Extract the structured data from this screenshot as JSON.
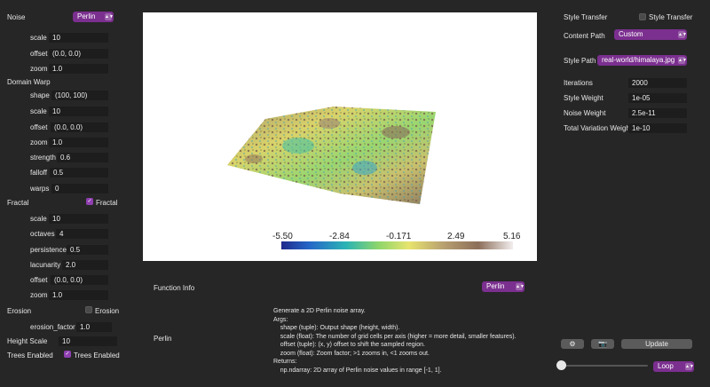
{
  "left": {
    "noise_label": "Noise",
    "noise_select": "Perlin",
    "noise_params": [
      {
        "label": "scale",
        "value": "10"
      },
      {
        "label": "offset",
        "value": "(0.0, 0.0)"
      },
      {
        "label": "zoom",
        "value": "1.0"
      }
    ],
    "domain_warp_label": "Domain Warp",
    "domain_warp_params": [
      {
        "label": "shape",
        "value": "(100, 100)"
      },
      {
        "label": "scale",
        "value": "10"
      },
      {
        "label": "offset",
        "value": "(0.0, 0.0)"
      },
      {
        "label": "zoom",
        "value": "1.0"
      },
      {
        "label": "strength",
        "value": "0.6"
      },
      {
        "label": "falloff",
        "value": "0.5"
      },
      {
        "label": "warps",
        "value": "0"
      }
    ],
    "fractal_label": "Fractal",
    "fractal_checkbox_label": "Fractal",
    "fractal_params": [
      {
        "label": "scale",
        "value": "10"
      },
      {
        "label": "octaves",
        "value": "4"
      },
      {
        "label": "persistence",
        "value": "0.5"
      },
      {
        "label": "lacunarity",
        "value": "2.0"
      },
      {
        "label": "offset",
        "value": "(0.0, 0.0)"
      },
      {
        "label": "zoom",
        "value": "1.0"
      }
    ],
    "erosion_label": "Erosion",
    "erosion_checkbox_label": "Erosion",
    "erosion_factor_label": "erosion_factor",
    "erosion_factor_value": "1.0",
    "height_scale_label": "Height Scale",
    "height_scale_value": "10",
    "trees_label": "Trees Enabled",
    "trees_checkbox_label": "Trees Enabled"
  },
  "colorbar": {
    "ticks": [
      "-5.50",
      "-2.84",
      "-0.171",
      "2.49",
      "5.16"
    ]
  },
  "function_info": {
    "label": "Function Info",
    "select": "Perlin",
    "name": "Perlin",
    "doc_lines": [
      "Generate a 2D Perlin noise array.",
      "Args:",
      "    shape (tuple): Output shape (height, width).",
      "    scale (float): The number of grid cells per axis (higher = more detail, smaller features).",
      "    offset (tuple): (x, y) offset to shift the sampled region.",
      "    zoom (float): Zoom factor; >1 zooms in, <1 zooms out.",
      "Returns:",
      "    np.ndarray: 2D array of Perlin noise values in range [-1, 1]."
    ]
  },
  "right": {
    "style_transfer_label": "Style Transfer",
    "style_transfer_checkbox_label": "Style Transfer",
    "content_path_label": "Content Path",
    "content_path_select": "Custom",
    "style_path_label": "Style Path",
    "style_path_select": "real-world/himalaya.jpg",
    "iterations_label": "Iterations",
    "iterations_value": "2000",
    "style_weight_label": "Style Weight",
    "style_weight_value": "1e-05",
    "noise_weight_label": "Noise Weight",
    "noise_weight_value": "2.5e-11",
    "tv_weight_label": "Total Variation Weight",
    "tv_weight_value": "1e-10",
    "update_label": "Update",
    "loop_select": "Loop"
  },
  "colors": {
    "accent": "#7b2f8f",
    "background": "#262626",
    "field": "#1d1d1d"
  }
}
